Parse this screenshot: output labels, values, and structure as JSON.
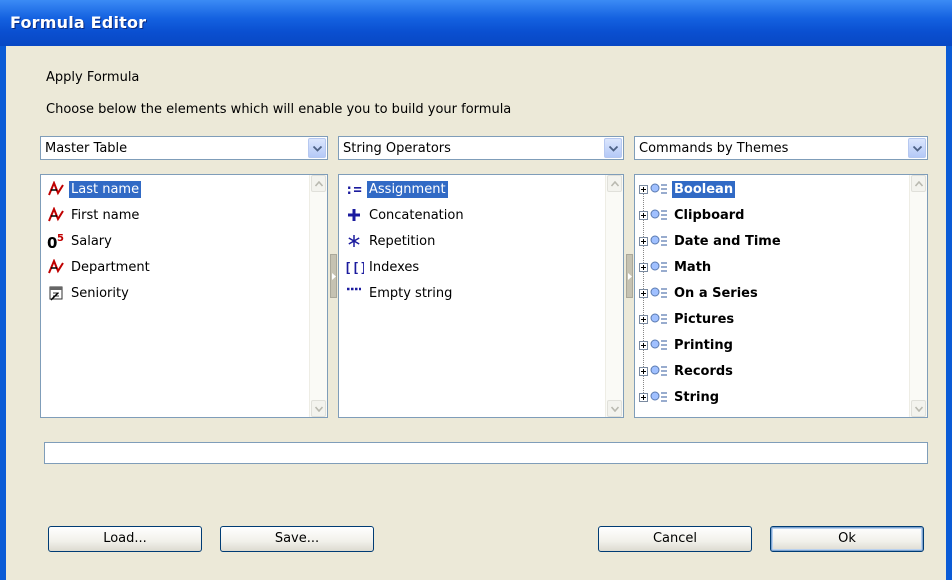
{
  "window": {
    "title": "Formula Editor"
  },
  "intro": {
    "heading": "Apply Formula",
    "instruction": "Choose below the elements which will enable you to build your formula"
  },
  "panels": [
    {
      "selector_value": "Master Table",
      "items": [
        {
          "label": "Last name",
          "icon": "text-field-icon",
          "selected": true
        },
        {
          "label": "First name",
          "icon": "text-field-icon",
          "selected": false
        },
        {
          "label": "Salary",
          "icon": "numeric-field-icon",
          "selected": false
        },
        {
          "label": "Department",
          "icon": "text-field-icon",
          "selected": false
        },
        {
          "label": "Seniority",
          "icon": "date-field-icon",
          "selected": false
        }
      ]
    },
    {
      "selector_value": "String Operators",
      "items": [
        {
          "label": "Assignment",
          "icon": "assignment-icon",
          "selected": true
        },
        {
          "label": "Concatenation",
          "icon": "plus-icon",
          "selected": false
        },
        {
          "label": "Repetition",
          "icon": "asterisk-icon",
          "selected": false
        },
        {
          "label": "Indexes",
          "icon": "brackets-icon",
          "selected": false
        },
        {
          "label": "Empty string",
          "icon": "ellipsis-icon",
          "selected": false
        }
      ]
    },
    {
      "selector_value": "Commands by Themes",
      "items": [
        {
          "label": "Boolean",
          "icon": "command-group-icon",
          "selected": true
        },
        {
          "label": "Clipboard",
          "icon": "command-group-icon",
          "selected": false
        },
        {
          "label": "Date and Time",
          "icon": "command-group-icon",
          "selected": false
        },
        {
          "label": "Math",
          "icon": "command-group-icon",
          "selected": false
        },
        {
          "label": "On a Series",
          "icon": "command-group-icon",
          "selected": false
        },
        {
          "label": "Pictures",
          "icon": "command-group-icon",
          "selected": false
        },
        {
          "label": "Printing",
          "icon": "command-group-icon",
          "selected": false
        },
        {
          "label": "Records",
          "icon": "command-group-icon",
          "selected": false
        },
        {
          "label": "String",
          "icon": "command-group-icon",
          "selected": false
        }
      ]
    }
  ],
  "formula": {
    "value": ""
  },
  "buttons": {
    "load": "Load...",
    "save": "Save...",
    "cancel": "Cancel",
    "ok": "Ok"
  },
  "colors": {
    "selection": "#316ac5",
    "titlebar": "#0a4fd0",
    "dialog_bg": "#ece9d8"
  }
}
